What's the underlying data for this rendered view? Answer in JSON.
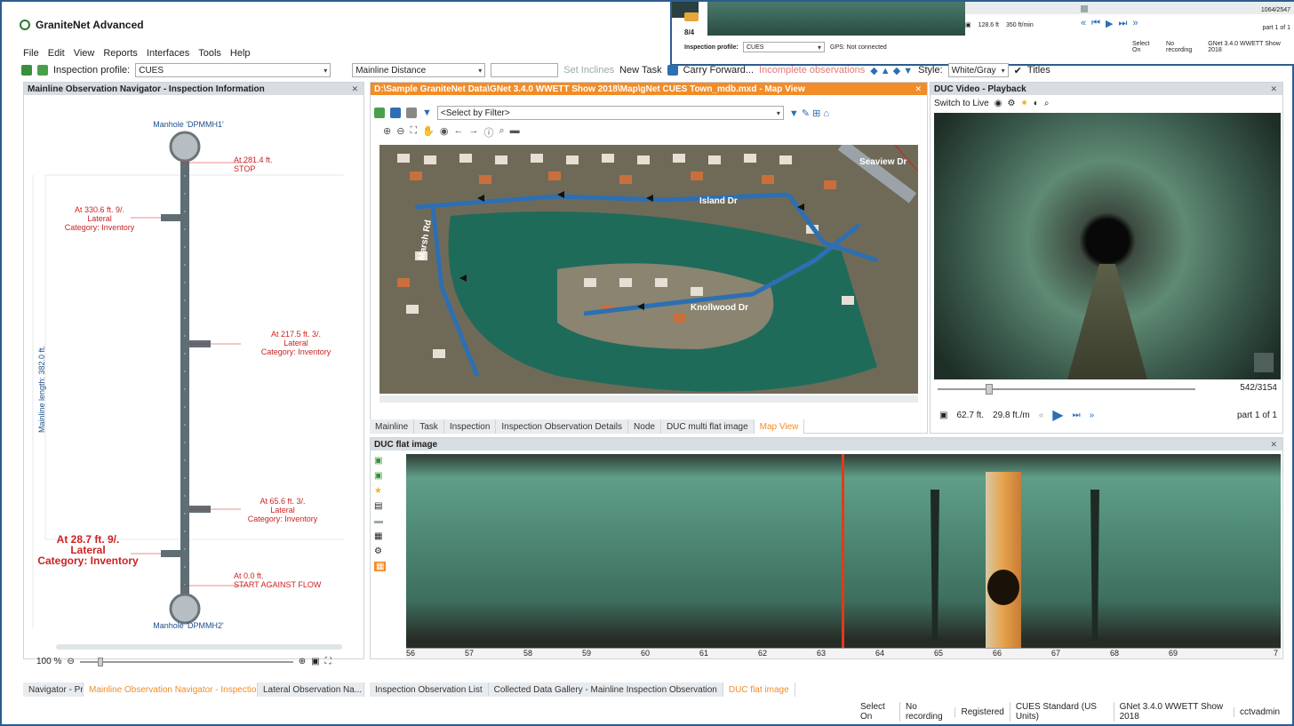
{
  "app": {
    "title": "GraniteNet Advanced"
  },
  "menu": [
    "File",
    "Edit",
    "View",
    "Reports",
    "Interfaces",
    "Tools",
    "Help"
  ],
  "toolbar": {
    "inspection_profile_label": "Inspection profile:",
    "inspection_profile_value": "CUES",
    "distance_value": "Mainline Distance",
    "set_inclines": "Set Inclines",
    "new_task": "New Task",
    "carry_forward": "Carry Forward...",
    "incomplete_observations": "Incomplete observations",
    "style_label": "Style:",
    "style_value": "White/Gray",
    "titles": "Titles"
  },
  "inset": {
    "counter": "8/4",
    "inspection_profile_label": "Inspection profile:",
    "inspection_profile_value": "CUES",
    "gps": "GPS: Not connected",
    "distance": "128.6 ft",
    "speed": "350 ft/min",
    "frame": "1064/2547",
    "part": "part 1 of 1",
    "recording": "No recording",
    "version": "GNet 3.4.0 WWETT Show 2018",
    "select_on": "Select On"
  },
  "navigator": {
    "title": "Mainline Observation Navigator - Inspection Information",
    "manhole_top": "Manhole 'DPMMH1'",
    "manhole_bottom": "Manhole 'DPMMH2'",
    "length_label": "Mainline  length:  382.0 ft.",
    "obs": [
      {
        "line1": "At 281.4 ft.",
        "line2": "STOP",
        "line3": ""
      },
      {
        "line1": "At 330.6 ft. 9/.",
        "line2": "Lateral",
        "line3": "Category: Inventory"
      },
      {
        "line1": "At 217.5 ft. 3/.",
        "line2": "Lateral",
        "line3": "Category: Inventory"
      },
      {
        "line1": "At 65.6 ft. 3/.",
        "line2": "Lateral",
        "line3": "Category: Inventory"
      },
      {
        "line1": "At 28.7 ft. 9/.",
        "line2": "Lateral",
        "line3": "Category: Inventory"
      },
      {
        "line1": "At 0.0 ft.",
        "line2": "START AGAINST FLOW",
        "line3": ""
      }
    ],
    "zoom": "100 %",
    "tabs": [
      "Navigator - Pr...",
      "Mainline Observation Navigator - Inspection I...",
      "Lateral Observation Na..."
    ]
  },
  "map": {
    "title": "D:\\Sample GraniteNet Data\\GNet 3.4.0 WWETT Show 2018\\Map\\gNet CUES Town_mdb.mxd - Map View",
    "filter": "<Select by Filter>",
    "streets": [
      "Seaview Dr",
      "Island Dr",
      "Knollwood Dr",
      "Marsh Rd"
    ],
    "tabs": [
      "Mainline",
      "Task",
      "Inspection",
      "Inspection Observation Details",
      "Node",
      "DUC multi flat image",
      "Map View"
    ]
  },
  "video": {
    "title": "DUC Video - Playback",
    "switch_live": "Switch to Live",
    "frame": "542/3154",
    "distance": "62.7 ft.",
    "speed": "29.8 ft./m",
    "part": "part 1 of 1"
  },
  "flat": {
    "title": "DUC flat image",
    "ticks": [
      "56",
      "57",
      "58",
      "59",
      "60",
      "61",
      "62",
      "63",
      "64",
      "65",
      "66",
      "67",
      "68",
      "69",
      "7"
    ],
    "tabs": [
      "Inspection Observation List",
      "Collected Data Gallery - Mainline Inspection Observation",
      "DUC flat image"
    ]
  },
  "status": {
    "select_on": "Select On",
    "recording": "No recording",
    "registered": "Registered",
    "standard": "CUES Standard (US Units)",
    "version": "GNet 3.4.0 WWETT Show 2018",
    "user": "cctvadmin"
  },
  "colors": {
    "accent": "#f28c28",
    "frame": "#2c5d8f",
    "pipe": "#5f6e74",
    "annot": "#c22222"
  }
}
